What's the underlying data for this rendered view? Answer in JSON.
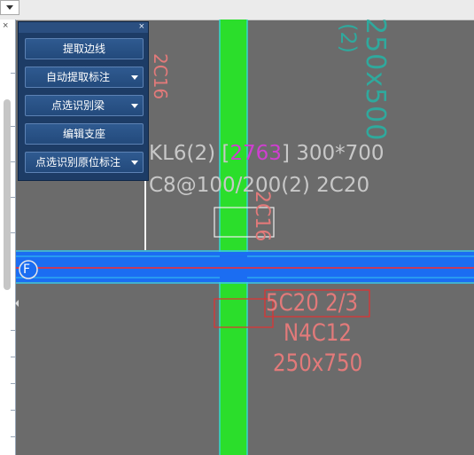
{
  "panel": {
    "close_label": "×",
    "buttons": [
      {
        "label": "提取边线",
        "dropdown": false
      },
      {
        "label": "自动提取标注",
        "dropdown": true
      },
      {
        "label": "点选识别梁",
        "dropdown": true
      },
      {
        "label": "编辑支座",
        "dropdown": false
      },
      {
        "label": "点选识别原位标注",
        "dropdown": true
      }
    ]
  },
  "left_panel": {
    "close_label": "×"
  },
  "drawing": {
    "column_label_top": "2C16",
    "column_size_top": "250x500",
    "column_size_top_sub": "(2)",
    "beam_label_a": "KL6(2) [",
    "beam_label_b": "2763",
    "beam_label_c": "] 300*700",
    "beam_stirrup_a": "C8@100",
    "beam_stirrup_b": "/200(2) 2C20",
    "column_box_label": "2C16",
    "grid_axis_label": "F",
    "column_label_bottom": "5C20 2/3",
    "column_sub_bottom": "N4C12",
    "column_size_bottom": "250x750"
  },
  "colors": {
    "canvas_bg": "#6b6b6b",
    "column_fill": "#2bde2b",
    "beam_fill": "#1b6df2",
    "axis_red": "#ff2a2a",
    "annotation_red": "#e27a7a",
    "annotation_teal": "#2fa99d",
    "label_gray": "#c8c8c8",
    "highlight_magenta": "#cf3fd0"
  }
}
